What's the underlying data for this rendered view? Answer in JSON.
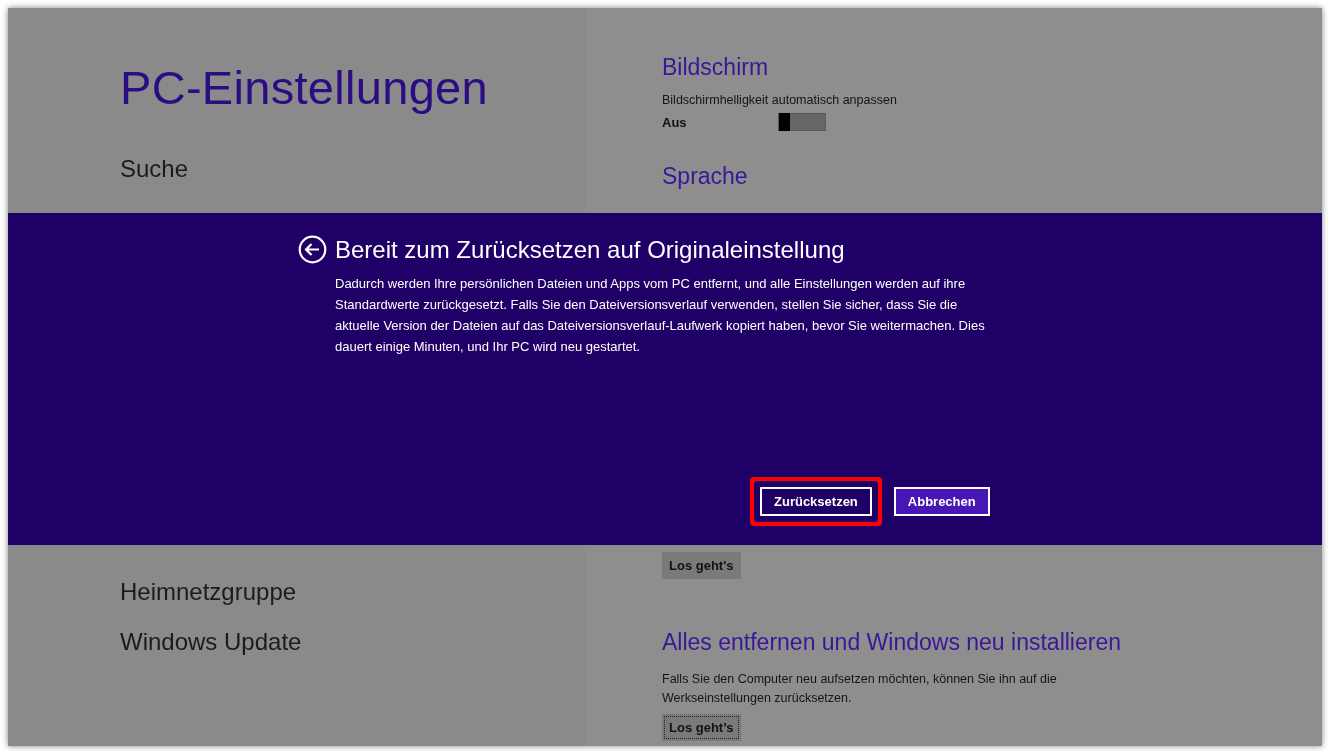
{
  "app_title": "PC-Einstellungen",
  "sidebar": {
    "items_top": [
      {
        "label": "Suche",
        "selected": false
      }
    ],
    "items_bottom": [
      {
        "label": "Heimnetzgruppe",
        "selected": false
      },
      {
        "label": "Windows Update",
        "selected": false
      }
    ]
  },
  "sections_top": [
    {
      "heading": "Bildschirm",
      "setting_label": "Bildschirmhelligkeit automatisch anpassen",
      "toggle": {
        "state_text": "Aus",
        "on": false
      }
    },
    {
      "heading": "Sprache"
    }
  ],
  "sections_bottom": [
    {
      "button": {
        "label": "Los geht's",
        "focused": false
      }
    },
    {
      "heading": "Alles entfernen und Windows neu installieren",
      "description": "Falls Sie den Computer neu aufsetzen möchten, können Sie ihn auf die Werkseinstellungen zurücksetzen.",
      "button": {
        "label": "Los geht’s",
        "focused": true
      }
    }
  ],
  "dialog": {
    "title": "Bereit zum Zurücksetzen auf Originaleinstellung",
    "message": "Dadurch werden Ihre persönlichen Dateien und Apps vom PC entfernt, und alle Einstellungen werden auf ihre Standardwerte zurückgesetzt. Falls Sie den Dateiversionsverlauf verwenden, stellen Sie sicher, dass Sie die aktuelle Version der Dateien auf das Dateiversionsverlauf-Laufwerk kopiert haben, bevor Sie weitermachen. Dies dauert einige Minuten, und Ihr PC wird neu gestartet.",
    "buttons": [
      {
        "label": "Zurücksetzen",
        "kind": "primary",
        "highlighted": true
      },
      {
        "label": "Abbrechen",
        "kind": "secondary",
        "highlighted": false
      }
    ]
  }
}
